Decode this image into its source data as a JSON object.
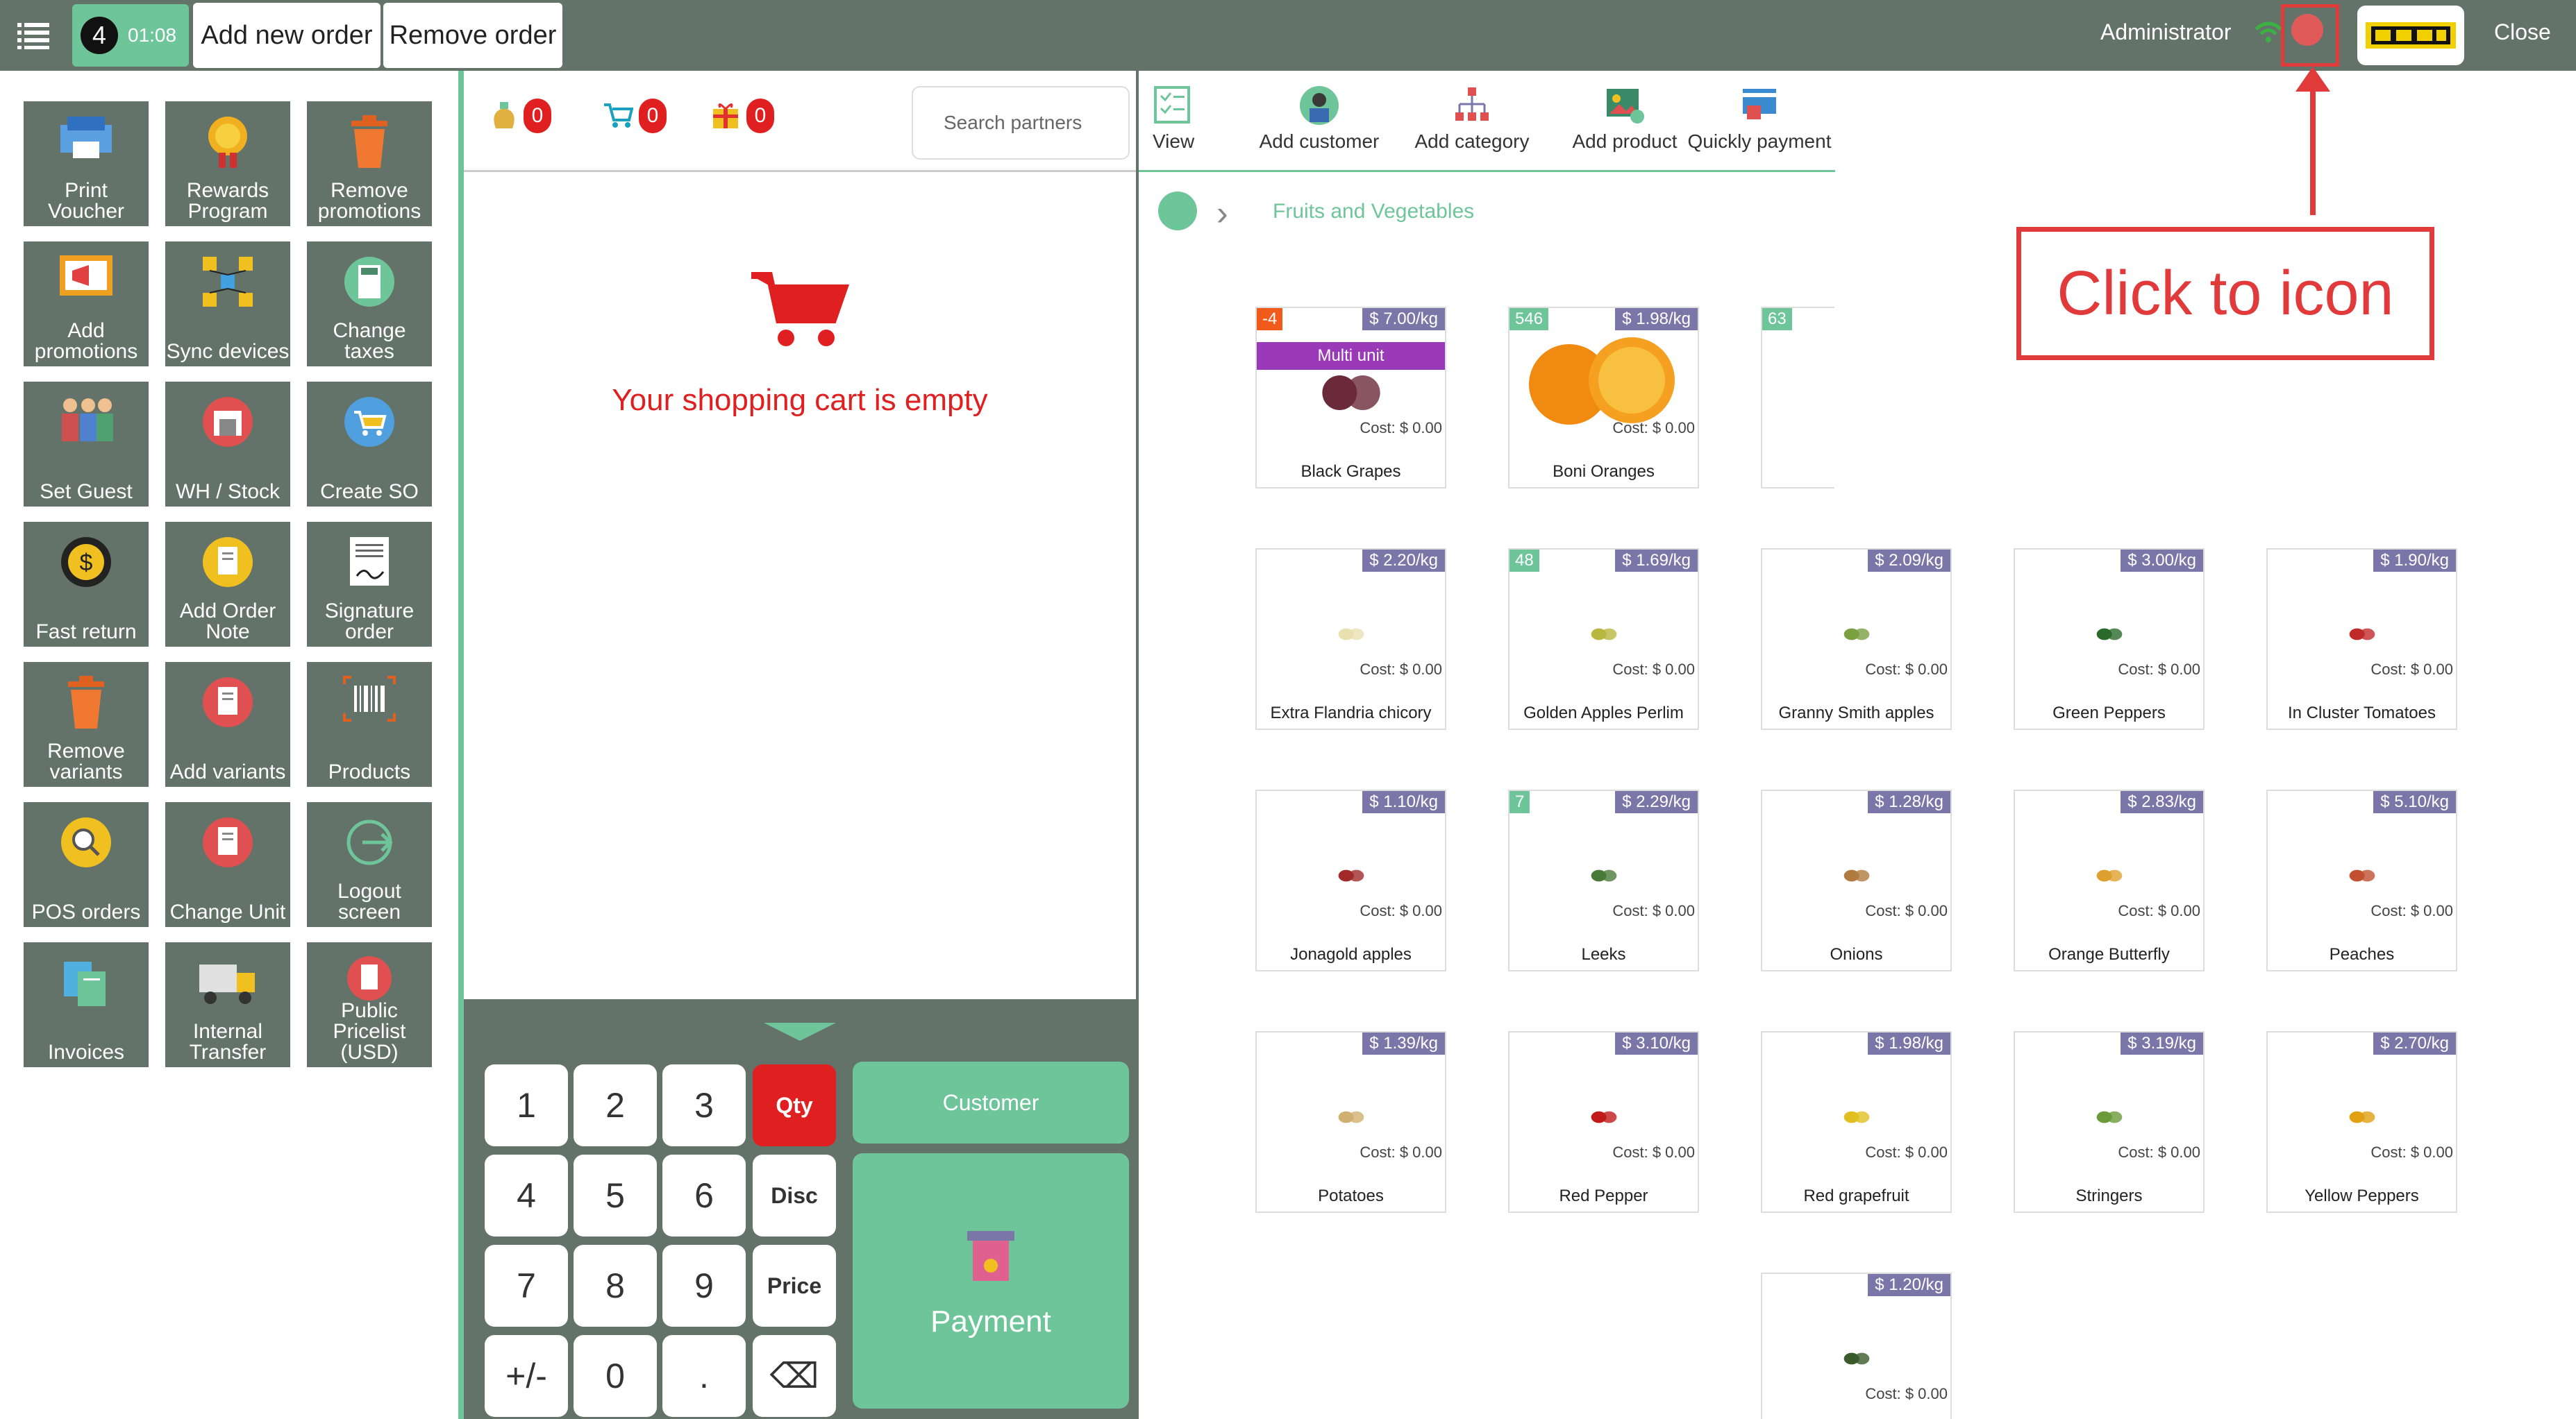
{
  "topbar": {
    "order_number": "4",
    "order_time": "01:08",
    "add_order_label": "Add new order",
    "remove_order_label": "Remove order",
    "user_label": "Administrator",
    "close_label": "Close",
    "icons": [
      "hamburger-menu-icon",
      "wifi-icon",
      "status-icon",
      "company-logo"
    ]
  },
  "left_panel": {
    "tiles": [
      {
        "label": "Print Voucher",
        "icon": "voucher-icon"
      },
      {
        "label": "Rewards Program",
        "icon": "rewards-icon"
      },
      {
        "label": "Remove promotions",
        "icon": "trash-icon"
      },
      {
        "label": "Add promotions",
        "icon": "megaphone-icon"
      },
      {
        "label": "Sync devices",
        "icon": "sync-icon"
      },
      {
        "label": "Change taxes",
        "icon": "calculator-icon"
      },
      {
        "label": "Set Guest",
        "icon": "guests-icon"
      },
      {
        "label": "WH / Stock",
        "icon": "warehouse-icon"
      },
      {
        "label": "Create SO",
        "icon": "cart-icon"
      },
      {
        "label": "Fast return",
        "icon": "return-icon"
      },
      {
        "label": "Add Order Note",
        "icon": "note-icon"
      },
      {
        "label": "Signature order",
        "icon": "signature-icon"
      },
      {
        "label": "Remove variants",
        "icon": "trash-icon"
      },
      {
        "label": "Add variants",
        "icon": "list-icon"
      },
      {
        "label": "Products",
        "icon": "barcode-icon"
      },
      {
        "label": "POS orders",
        "icon": "search-icon"
      },
      {
        "label": "Change Unit",
        "icon": "list-icon"
      },
      {
        "label": "Logout screen",
        "icon": "logout-icon"
      },
      {
        "label": "Invoices",
        "icon": "invoice-icon"
      },
      {
        "label": "Internal Transfer",
        "icon": "truck-icon"
      },
      {
        "label": "Public Pricelist (USD)",
        "icon": "pricelist-icon"
      }
    ]
  },
  "middle_panel": {
    "counters": [
      {
        "icon": "money-bag-icon",
        "value": "0"
      },
      {
        "icon": "cart-icon",
        "value": "0"
      },
      {
        "icon": "gift-icon",
        "value": "0"
      }
    ],
    "search_placeholder": "Search partners",
    "empty_cart_message": "Your shopping cart is empty"
  },
  "numpad": {
    "keys": [
      "1",
      "2",
      "3",
      "Qty",
      "4",
      "5",
      "6",
      "Disc",
      "7",
      "8",
      "9",
      "Price",
      "+/-",
      "0",
      ".",
      "⌫"
    ],
    "active_mode": "Qty",
    "customer_label": "Customer",
    "payment_label": "Payment"
  },
  "right_panel": {
    "toolbar": [
      {
        "label": "View",
        "icon": "view-list-icon"
      },
      {
        "label": "Add customer",
        "icon": "add-customer-icon"
      },
      {
        "label": "Add category",
        "icon": "add-category-icon"
      },
      {
        "label": "Add product",
        "icon": "add-product-icon"
      },
      {
        "label": "Quickly payment",
        "icon": "quick-payment-icon"
      }
    ],
    "breadcrumb": {
      "home_icon": "home-icon",
      "category": "Fruits and Vegetables"
    },
    "products": [
      {
        "name": "Black Grapes",
        "price": "$ 7.00/kg",
        "qty": "-4",
        "cost": "Cost: $ 0.00",
        "tag": "Multi unit",
        "color": "#6b2a3a"
      },
      {
        "name": "Boni Oranges",
        "price": "$ 1.98/kg",
        "qty": "546",
        "cost": "Cost: $ 0.00",
        "color": "#f08a10"
      },
      {
        "name": "",
        "price": "",
        "qty": "63",
        "cost": "",
        "color": "#ffffff"
      },
      {
        "name": "Extra Flandria chicory",
        "price": "$ 2.20/kg",
        "qty": "",
        "cost": "Cost: $ 0.00",
        "color": "#e8e0b0"
      },
      {
        "name": "Golden Apples Perlim",
        "price": "$ 1.69/kg",
        "qty": "48",
        "cost": "Cost: $ 0.00",
        "color": "#b8b840"
      },
      {
        "name": "Granny Smith apples",
        "price": "$ 2.09/kg",
        "qty": "",
        "cost": "Cost: $ 0.00",
        "color": "#7aa040"
      },
      {
        "name": "Green Peppers",
        "price": "$ 3.00/kg",
        "qty": "",
        "cost": "Cost: $ 0.00",
        "color": "#2a6a2a"
      },
      {
        "name": "In Cluster Tomatoes",
        "price": "$ 1.90/kg",
        "qty": "",
        "cost": "Cost: $ 0.00",
        "color": "#c02a2a"
      },
      {
        "name": "Jonagold apples",
        "price": "$ 1.10/kg",
        "qty": "",
        "cost": "Cost: $ 0.00",
        "color": "#a02a2a"
      },
      {
        "name": "Leeks",
        "price": "$ 2.29/kg",
        "qty": "7",
        "cost": "Cost: $ 0.00",
        "color": "#4a7a3a"
      },
      {
        "name": "Onions",
        "price": "$ 1.28/kg",
        "qty": "",
        "cost": "Cost: $ 0.00",
        "color": "#b07a40"
      },
      {
        "name": "Orange Butterfly",
        "price": "$ 2.83/kg",
        "qty": "",
        "cost": "Cost: $ 0.00",
        "color": "#e0a030"
      },
      {
        "name": "Peaches",
        "price": "$ 5.10/kg",
        "qty": "",
        "cost": "Cost: $ 0.00",
        "color": "#c05030"
      },
      {
        "name": "Potatoes",
        "price": "$ 1.39/kg",
        "qty": "",
        "cost": "Cost: $ 0.00",
        "color": "#d0b070"
      },
      {
        "name": "Red Pepper",
        "price": "$ 3.10/kg",
        "qty": "",
        "cost": "Cost: $ 0.00",
        "color": "#c01a1a"
      },
      {
        "name": "Red grapefruit",
        "price": "$ 1.98/kg",
        "qty": "",
        "cost": "Cost: $ 0.00",
        "color": "#e0c020"
      },
      {
        "name": "Stringers",
        "price": "$ 3.19/kg",
        "qty": "",
        "cost": "Cost: $ 0.00",
        "color": "#6a9a3a"
      },
      {
        "name": "Yellow Peppers",
        "price": "$ 2.70/kg",
        "qty": "",
        "cost": "Cost: $ 0.00",
        "color": "#e0a010"
      },
      {
        "name": "",
        "price": "$ 1.20/kg",
        "qty": "",
        "cost": "Cost: $ 0.00",
        "color": "#3a5a2a"
      }
    ]
  },
  "annotation": {
    "text": "Click to icon"
  },
  "colors": {
    "topbar": "#637369",
    "accent": "#6ec59a",
    "alert": "#e02020",
    "price_tag": "#7a76a8"
  }
}
